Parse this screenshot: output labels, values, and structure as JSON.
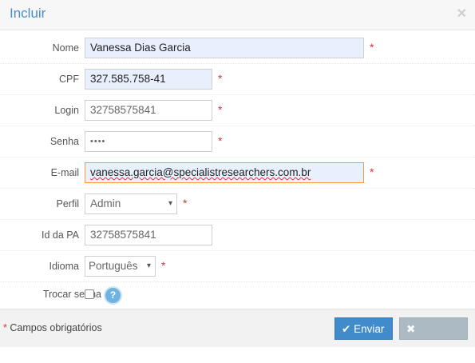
{
  "dialog": {
    "title": "Incluir",
    "close_icon": "close-icon"
  },
  "form": {
    "nome": {
      "label": "Nome",
      "value": "Vanessa Dias Garcia",
      "required": "*"
    },
    "cpf": {
      "label": "CPF",
      "value": "327.585.758-41",
      "required": "*"
    },
    "login": {
      "label": "Login",
      "value": "32758575841",
      "required": "*"
    },
    "senha": {
      "label": "Senha",
      "value": "••••",
      "required": "*"
    },
    "email": {
      "label": "E-mail",
      "value": "vanessa.garcia@specialistresearchers.com.br",
      "required": "*"
    },
    "perfil": {
      "label": "Perfil",
      "value": "Admin",
      "required": "*"
    },
    "id_pa": {
      "label": "Id da PA",
      "value": "32758575841"
    },
    "idioma": {
      "label": "Idioma",
      "value": "Português",
      "required": "*"
    },
    "trocar_senha": {
      "label": "Trocar senha",
      "help": "?"
    }
  },
  "footer": {
    "required_star": "*",
    "required_note": "Campos obrigatórios",
    "send_label": "Enviar",
    "cancel_label": "Cancelar"
  },
  "colors": {
    "accent": "#428bca",
    "title": "#4a8ec8",
    "required": "#d9363e",
    "focus_border": "#f59942"
  }
}
